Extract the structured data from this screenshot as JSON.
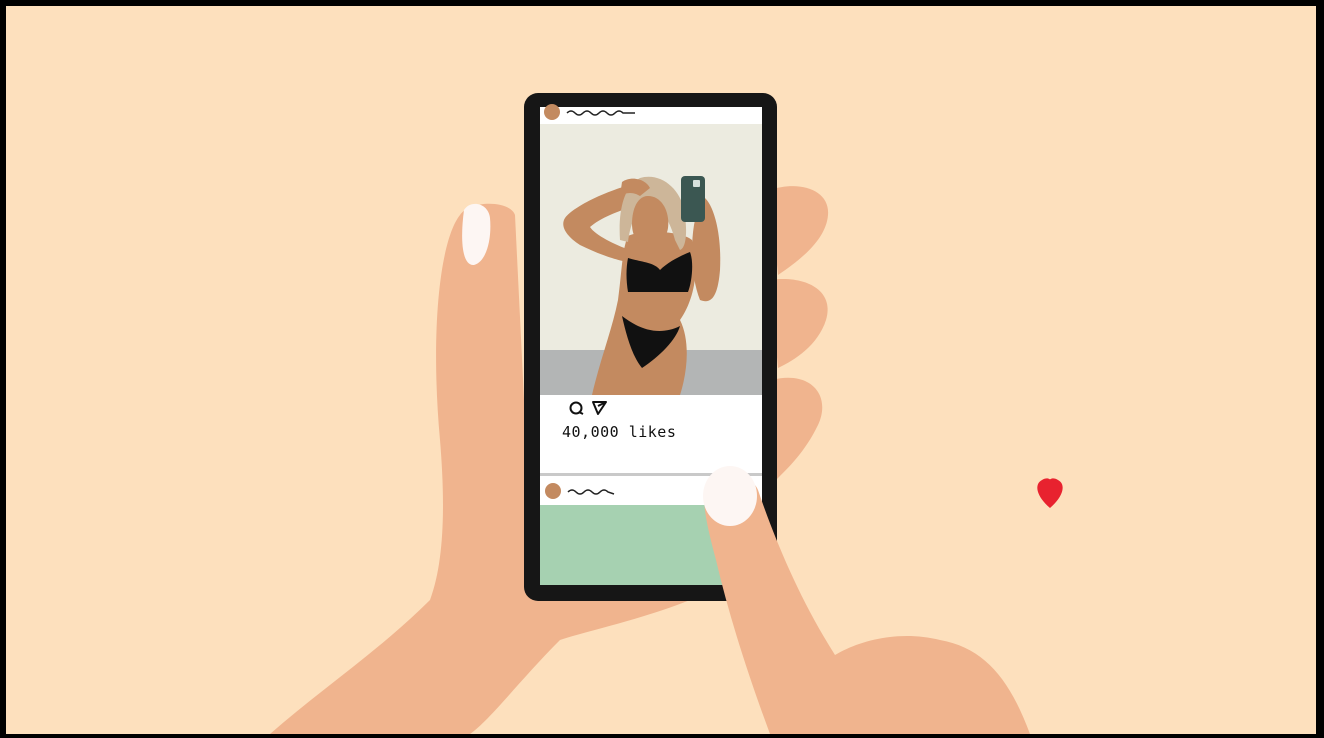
{
  "colors": {
    "frame": "#000000",
    "background": "#fde0bd",
    "skin": "#f0b48e",
    "nail": "#fdf6f3",
    "phone_body": "#161616",
    "screen": "#ffffff",
    "photo_wall": "#ecebe0",
    "photo_floor": "#b3b5b5",
    "body_tone": "#c38a60",
    "hair": "#cdb699",
    "swimsuit": "#111111",
    "phone_in_photo": "#3b5752",
    "heart": "#e8222f",
    "next_post": "#a6d1b1"
  },
  "post": {
    "likes_text": "40,000 likes",
    "liked": true,
    "icons": [
      "heart-icon",
      "comment-icon",
      "share-icon"
    ]
  },
  "next_post": {
    "color": "#a6d1b1"
  }
}
